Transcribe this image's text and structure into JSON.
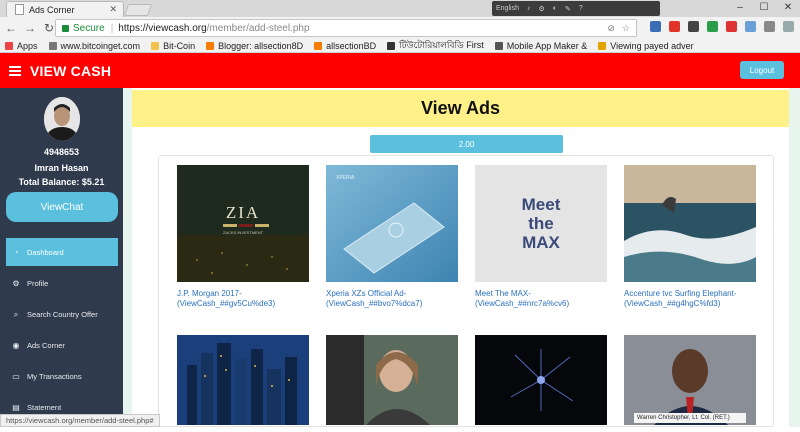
{
  "browser": {
    "tab_title": "Ads Corner",
    "secure_label": "Secure",
    "url_host": "https://viewcash.org",
    "url_path": "/member/add-steel.php",
    "language": "English",
    "bookmarks": [
      {
        "label": "Apps",
        "color": "#e44"
      },
      {
        "label": "www.bitcoinget.com",
        "color": "#777"
      },
      {
        "label": "Bit-Coin",
        "color": "#f2c14e"
      },
      {
        "label": "Blogger: allsection8D",
        "color": "#f57d00"
      },
      {
        "label": "allsectionBD",
        "color": "#f57d00"
      },
      {
        "label": "টিউটোরিয়ালবিডি First",
        "color": "#333"
      },
      {
        "label": "Mobile App Maker &",
        "color": "#555"
      },
      {
        "label": "Viewing payed adver",
        "color": "#e2a400"
      }
    ],
    "status_url": "https://viewcash.org/member/add-steel.php#"
  },
  "header": {
    "brand": "VIEW CASH",
    "logout_label": "Logout",
    "bg_color": "#fe0000"
  },
  "sidebar": {
    "user_id": "4948653",
    "user_name": "Imran Hasan",
    "balance": "Total Balance: $5.21",
    "viewchat_label": "ViewChat",
    "nav": [
      {
        "label": "Dashboard",
        "icon": "dashboard-icon",
        "active": true
      },
      {
        "label": "Profile",
        "icon": "gear-icon",
        "active": false
      },
      {
        "label": "Search Country Offer",
        "icon": "search-icon",
        "active": false
      },
      {
        "label": "Ads Corner",
        "icon": "eye-icon",
        "active": false
      },
      {
        "label": "My Transactions",
        "icon": "credit-card-icon",
        "active": false
      },
      {
        "label": "Statement",
        "icon": "clipboard-icon",
        "active": false
      }
    ]
  },
  "main": {
    "title": "View Ads",
    "rate": "2.00",
    "ads": [
      {
        "title": "J.P. Morgan 2017-(ViewCash_##gv5Cu%de3)",
        "thumb_text": "ZIA",
        "thumb_sub": "ZACKS INVESTMENT"
      },
      {
        "title": "Xperia XZs Official Ad-(ViewCash_##bvo7%dca7)",
        "thumb_text": "",
        "thumb_sub": "XPERIA"
      },
      {
        "title": "Meet The MAX-(ViewCash_##nrc7a%cv6)",
        "thumb_text": "Meet the MAX",
        "thumb_sub": ""
      },
      {
        "title": "Accenture tvc Surfing Elephant-(ViewCash_##g4hgC%fd3)",
        "thumb_text": "",
        "thumb_sub": ""
      },
      {
        "title": "",
        "thumb_text": "",
        "thumb_sub": ""
      },
      {
        "title": "",
        "thumb_text": "",
        "thumb_sub": ""
      },
      {
        "title": "",
        "thumb_text": "",
        "thumb_sub": ""
      },
      {
        "title": "",
        "thumb_text": "Warren Christopher, Lt. Col. (RET.)",
        "thumb_sub": ""
      }
    ]
  },
  "colors": {
    "accent": "#5bc0de",
    "sidebar": "#2f3a4d",
    "title_bar": "#fdf188",
    "link": "#2a6fbd"
  }
}
